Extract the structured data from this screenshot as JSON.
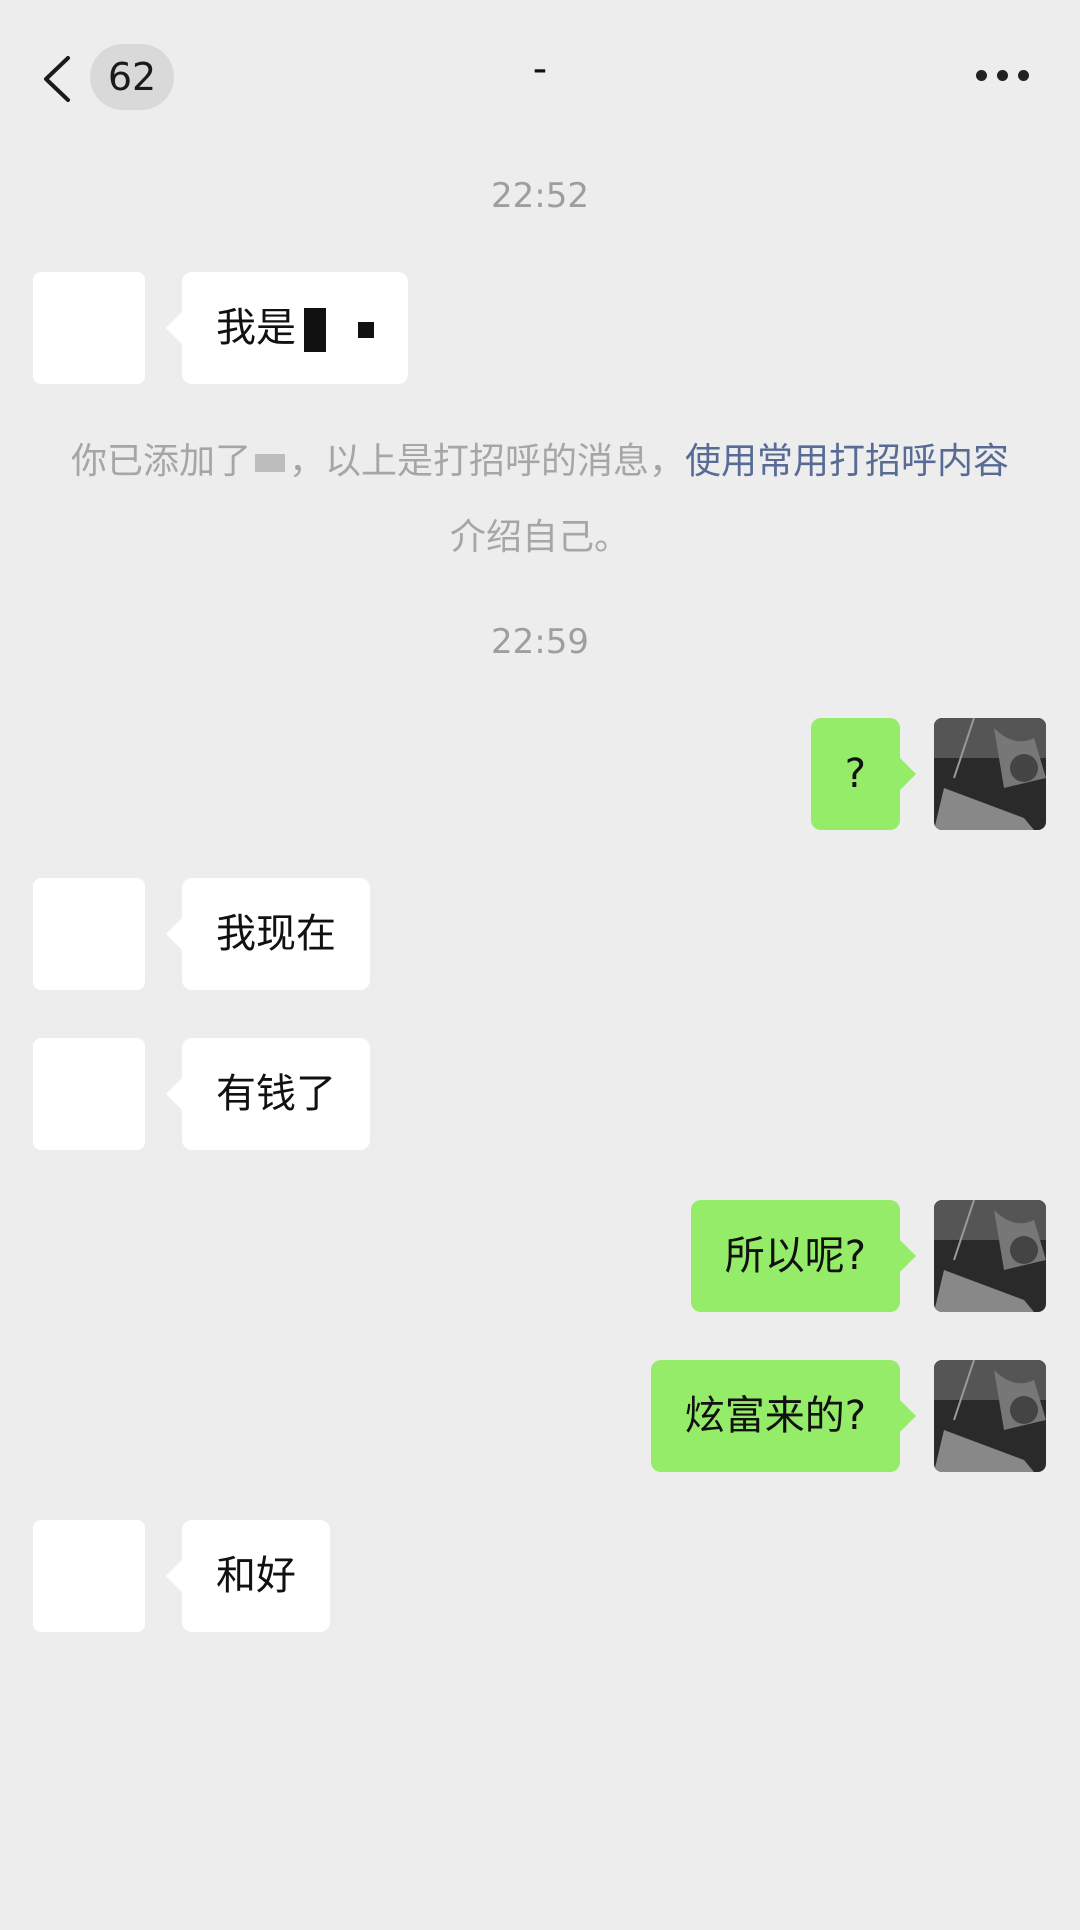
{
  "header": {
    "unread_count": "62",
    "title": "-"
  },
  "messages": [
    {
      "type": "time",
      "text": "22:52"
    },
    {
      "type": "in",
      "text": "我是"
    },
    {
      "type": "system",
      "part1": "你已添加了",
      "part2": "，以上是打招呼的消息，",
      "link": "使用常用打招呼内容",
      "part3": "介绍自己。"
    },
    {
      "type": "time",
      "text": "22:59"
    },
    {
      "type": "out",
      "text": "?"
    },
    {
      "type": "in",
      "text": "我现在"
    },
    {
      "type": "in",
      "text": "有钱了"
    },
    {
      "type": "out",
      "text": "所以呢?"
    },
    {
      "type": "out",
      "text": "炫富来的?"
    },
    {
      "type": "in",
      "text": "和好"
    }
  ],
  "colors": {
    "background": "#ededed",
    "outgoing_bubble": "#95ec69",
    "incoming_bubble": "#ffffff",
    "link": "#576b95"
  },
  "icons": [
    "back-arrow-icon",
    "more-dots-icon"
  ]
}
